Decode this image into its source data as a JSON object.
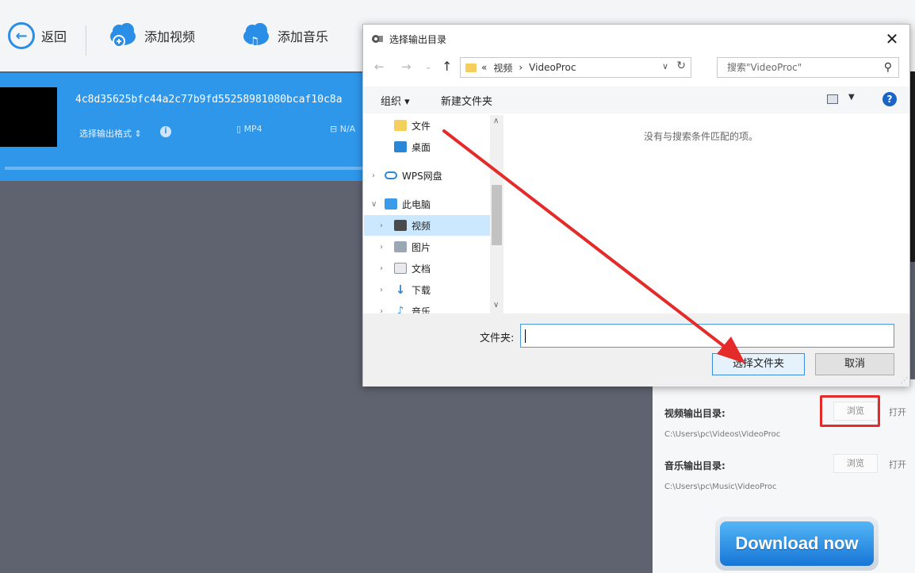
{
  "toolbar": {
    "back_label": "返回",
    "add_video_label": "添加视频",
    "add_music_label": "添加音乐"
  },
  "media": {
    "file_name": "4c8d35625bfc44a2c77b9fd55258981080bcaf10c8a",
    "format_label": "选择输出格式",
    "format_value": "MP4",
    "resolution_value": "N/A"
  },
  "dialog": {
    "title": "选择输出目录",
    "breadcrumb": [
      "«",
      "视频",
      "›",
      "VideoProc"
    ],
    "search_placeholder": "搜索\"VideoProc\"",
    "organize_label": "组织 ▾",
    "new_folder_label": "新建文件夹",
    "nav_items": [
      {
        "label": "文件",
        "icon": "folder-icon"
      },
      {
        "label": "桌面",
        "icon": "desktop-icon"
      },
      {
        "label": "WPS网盘",
        "icon": "cloud-icon"
      },
      {
        "label": "此电脑",
        "icon": "computer-icon"
      },
      {
        "label": "视频",
        "icon": "video-folder-icon",
        "selected": true
      },
      {
        "label": "图片",
        "icon": "pictures-icon"
      },
      {
        "label": "文档",
        "icon": "documents-icon"
      },
      {
        "label": "下载",
        "icon": "download-icon"
      },
      {
        "label": "音乐",
        "icon": "music-icon"
      }
    ],
    "empty_message": "没有与搜索条件匹配的项。",
    "folder_field_label": "文件夹:",
    "folder_field_value": "",
    "select_button": "选择文件夹",
    "cancel_button": "取消"
  },
  "output": {
    "video_dir_label": "视频输出目录:",
    "video_dir_path": "C:\\Users\\pc\\Videos\\VideoProc",
    "music_dir_label": "音乐输出目录:",
    "music_dir_path": "C:\\Users\\pc\\Music\\VideoProc",
    "browse_label": "浏览",
    "open_label": "打开"
  },
  "download_label": "Download now",
  "colors": {
    "accent": "#2f97ea",
    "annotation_red": "#e52a2a"
  }
}
